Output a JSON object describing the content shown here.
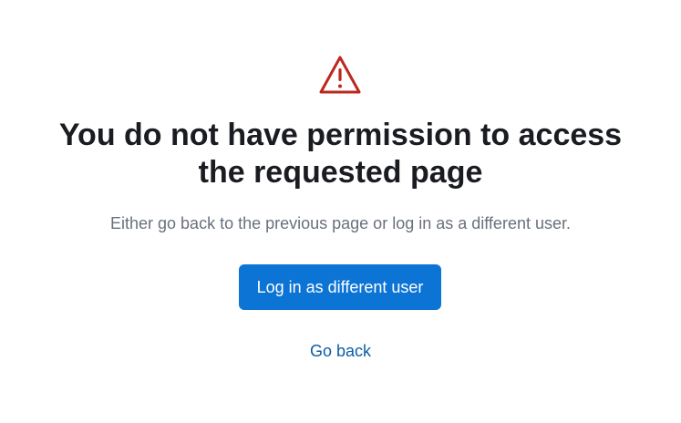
{
  "icon": {
    "name": "warning-triangle-icon",
    "color": "#bd271e"
  },
  "heading": {
    "line1": "You do not have permission to access",
    "line2": "the requested page"
  },
  "message": "Either go back to the previous page or log in as a different user.",
  "actions": {
    "login_label": "Log in as different user",
    "back_label": "Go back"
  },
  "colors": {
    "primary": "#0b74d5",
    "link": "#0a5ea8",
    "text": "#1a1c21",
    "muted": "#69707d"
  }
}
